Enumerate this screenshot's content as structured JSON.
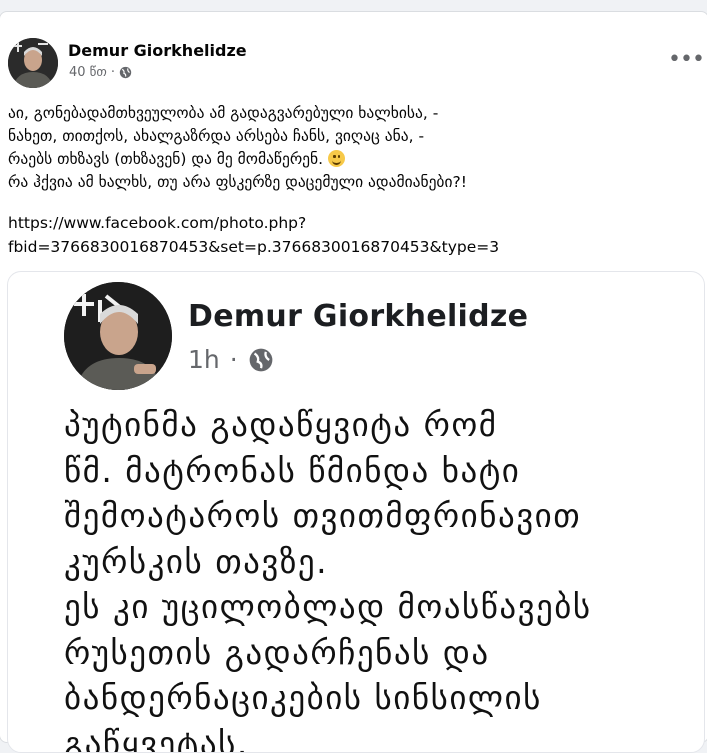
{
  "post": {
    "author": "Demur Giorkhelidze",
    "time": "40 წთ",
    "dot": "·",
    "privacy_icon": "globe-icon",
    "more_icon": "more-options-icon",
    "more_label": "•••",
    "text_lines": [
      "აი, გონებადამთხვეულობა ამ გადაგვარებული ხალხისა, -",
      "ნახეთ, თითქოს, ახალგაზრდა არსება ჩანს, ვიღაც ანა, -",
      "რაებს თხზავს (თხზავენ) და მე მომაწერენ. ",
      "რა ჰქვია ამ ხალხს, თუ არა ფსკერზე დაცემული ადამიანები?!"
    ],
    "emoji": "smiling-face-emoji",
    "link_lines": [
      "https://www.facebook.com/photo.php?",
      "fbid=3766830016870453&set=p.3766830016870453&type=3"
    ]
  },
  "shared_screenshot": {
    "author": "Demur Giorkhelidze",
    "time": "1h",
    "dot": "·",
    "body_lines": [
      "პუტინმა გადაწყვიტა რომ",
      "წმ. მატრონას წმინდა ხატი",
      "შემოატაროს თვითმფრინავით",
      "კურსკის თავზე.",
      "ეს კი უცილობლად მოასწავებს",
      "რუსეთის გადარჩენას და",
      "ბანდერნაციკების სინსილის",
      "გაწყვეტას."
    ]
  },
  "colors": {
    "background": "#f0f2f5",
    "card": "#ffffff",
    "text": "#050505",
    "secondary": "#65676b"
  }
}
